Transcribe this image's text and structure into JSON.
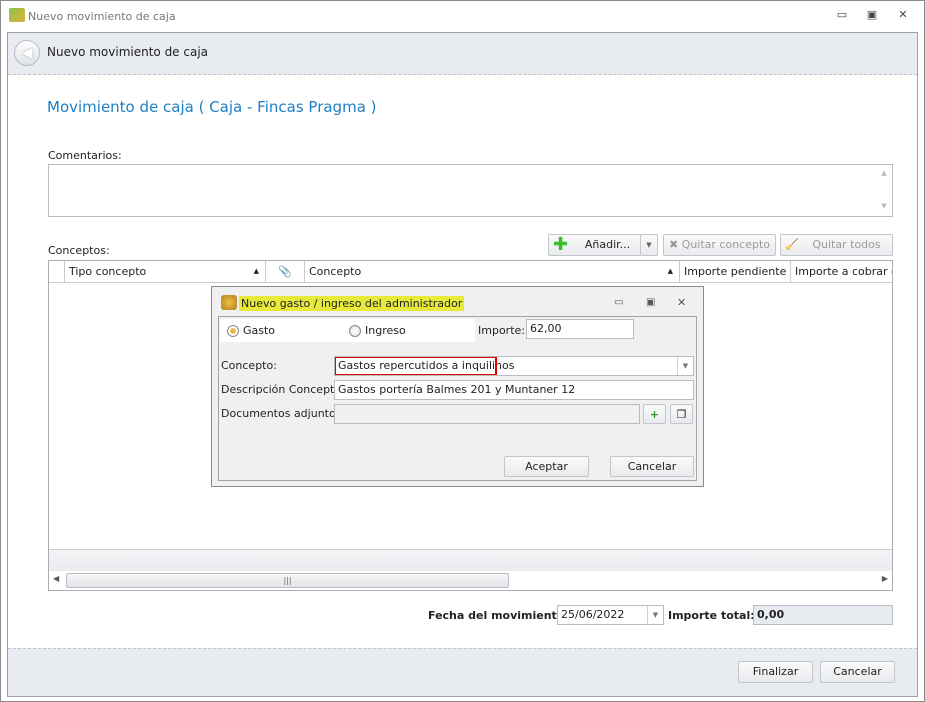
{
  "window": {
    "title": "Nuevo movimiento de caja",
    "minimize": "▭",
    "maximize": "▣",
    "close": "✕"
  },
  "header": {
    "title": "Nuevo movimiento de caja"
  },
  "page": {
    "title": "Movimiento de caja ( Caja - Fincas Pragma )",
    "comments_label": "Comentarios:",
    "comments_value": "",
    "conceptos_label": "Conceptos:"
  },
  "toolbar": {
    "add": "Añadir...",
    "remove": "Quitar concepto",
    "remove_all": "Quitar todos"
  },
  "grid": {
    "columns": [
      "Tipo concepto",
      "",
      "Concepto",
      "Importe pendiente",
      "Importe a cobrar o p"
    ],
    "rows": []
  },
  "dialog": {
    "title": "Nuevo gasto / ingreso del administrador",
    "radio_gasto": "Gasto",
    "radio_ingreso": "Ingreso",
    "importe_label": "Importe:",
    "importe_value": "62,00",
    "concepto_label": "Concepto:",
    "concepto_value": "Gastos repercutidos a inquilinos",
    "descripcion_label": "Descripción Concepto:",
    "descripcion_value": "Gastos portería Balmes 201 y Muntaner 12",
    "docs_label": "Documentos adjuntos:",
    "docs_value": "",
    "accept": "Aceptar",
    "cancel": "Cancelar"
  },
  "footer": {
    "fecha_label": "Fecha del movimiento",
    "fecha_value": "25/06/2022",
    "total_label": "Importe total:",
    "total_value": "0,00",
    "finish": "Finalizar",
    "cancel": "Cancelar"
  },
  "colors": {
    "accent": "#1e7fc4",
    "highlight": "#e8ea3a",
    "error": "#e00000"
  }
}
